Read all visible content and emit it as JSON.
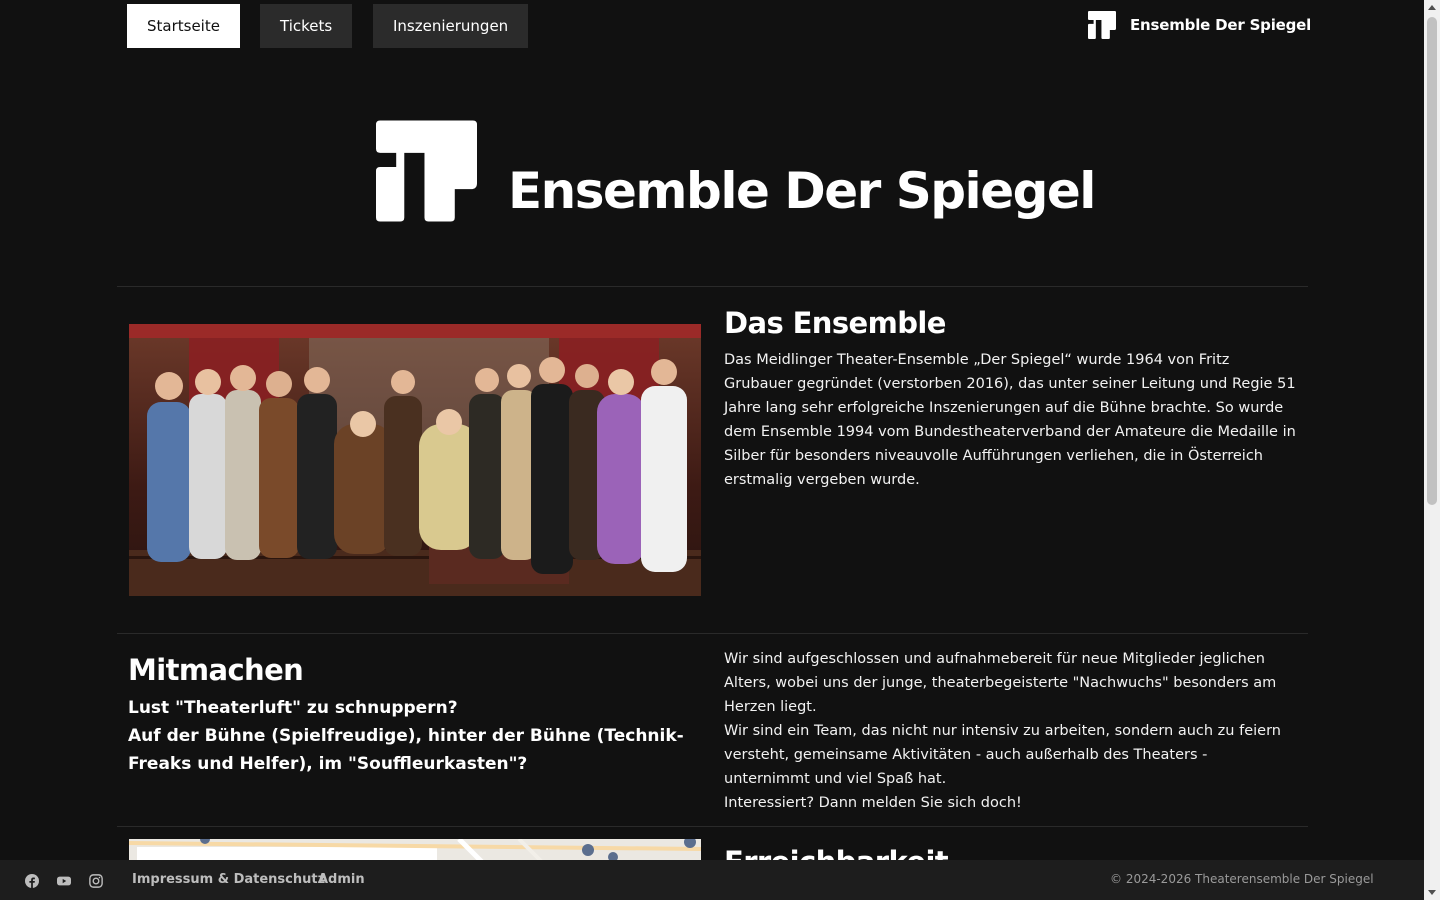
{
  "nav": {
    "items": [
      {
        "label": "Startseite",
        "active": true
      },
      {
        "label": "Tickets",
        "active": false
      },
      {
        "label": "Inszenierungen",
        "active": false
      }
    ],
    "brand": "Ensemble Der Spiegel",
    "logo_icon": "theater-logo-icon"
  },
  "hero": {
    "title": "Ensemble Der Spiegel"
  },
  "ensemble": {
    "heading": "Das Ensemble",
    "text": "Das Meidlinger Theater-Ensemble „Der Spiegel“ wurde 1964 von Fritz Grubauer gegründet (verstorben 2016), das unter seiner Leitung und Regie 51 Jahre lang sehr erfolgreiche Inszenierungen auf die Bühne brachte. So wurde dem Ensemble 1994 vom Bundestheaterverband der Amateure die Medaille in Silber für besonders niveauvolle Aufführungen verliehen, die in Österreich erstmalig vergeben wurde."
  },
  "mitmachen": {
    "heading": "Mitmachen",
    "sub1": "Lust \"Theaterluft\" zu schnuppern?",
    "sub2": "Auf der Bühne (Spielfreudige), hinter der Bühne (Technik-Freaks und Helfer), im \"Souffleurkasten\"?",
    "p1": "Wir sind aufgeschlossen und aufnahmebereit für neue Mitglieder jeglichen Alters, wobei uns der junge, theaterbegeisterte \"Nachwuchs\" besonders am Herzen liegt.",
    "p2": "Wir sind ein Team, das nicht nur intensiv zu arbeiten, sondern auch zu feiern versteht, gemeinsame Aktivitäten - auch außerhalb des Theaters - unternimmt und viel Spaß hat.",
    "p3": "Interessiert? Dann melden Sie sich doch!"
  },
  "erreichbarkeit": {
    "heading": "Erreichbarkeit"
  },
  "footer": {
    "icons": [
      "facebook-icon",
      "youtube-icon",
      "instagram-icon"
    ],
    "links": [
      "Impressum & Datenschutz",
      "Admin"
    ],
    "copyright": "© 2024-2026 Theaterensemble Der Spiegel"
  },
  "colors": {
    "background": "#111111",
    "nav_button": "#2b2b2b",
    "footer": "#1d1d1d"
  }
}
